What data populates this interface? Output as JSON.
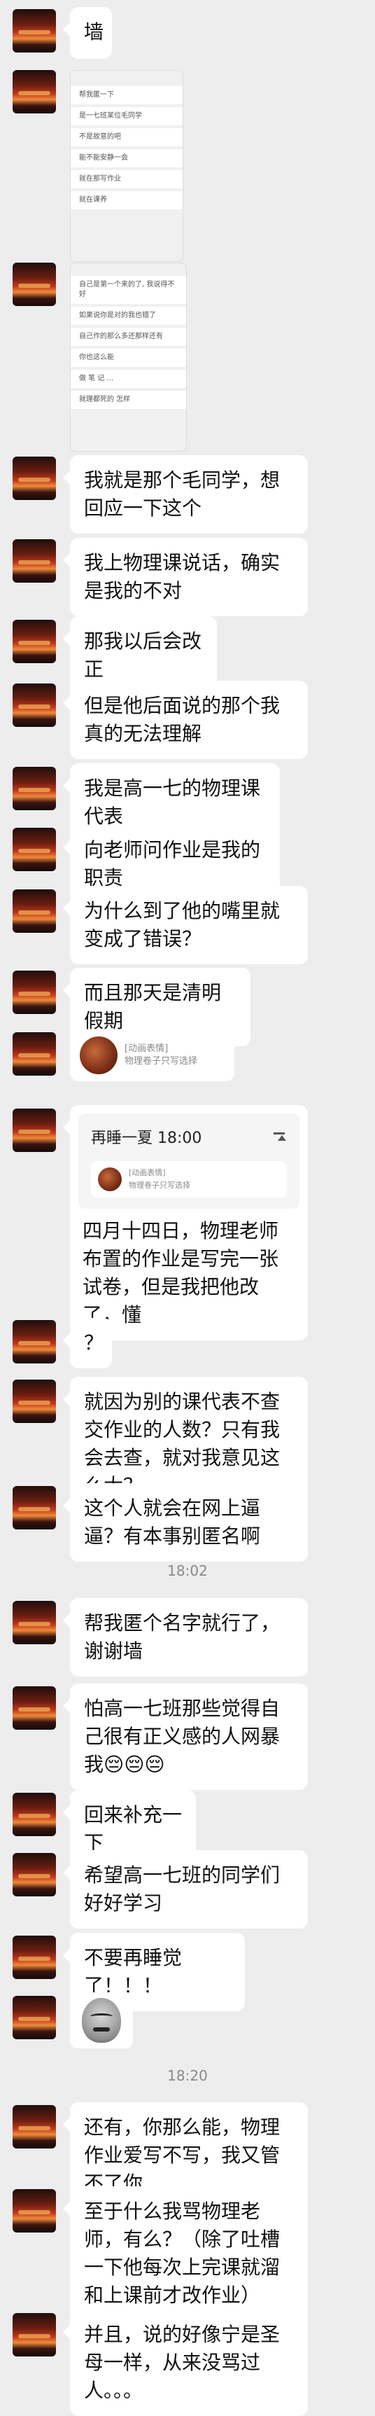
{
  "messages": {
    "m1": "墙",
    "m3": "我就是那个毛同学，想回应一下这个",
    "m4": "我上物理课说话，确实是我的不对",
    "m5": "那我以后会改正",
    "m6": "但是他后面说的那个我真的无法理解",
    "m7": "我是高一七的物理课代表",
    "m8": "向老师问作业是我的职责",
    "m9": "为什么到了他的嘴里就变成了错误？",
    "m10": "而且那天是清明假期",
    "m13": "？",
    "m14": "就因为别的课代表不查交作业的人数？只有我会去查，就对我意见这么大？",
    "m15": "这个人就会在网上逼逼？有本事别匿名啊",
    "m16": "帮我匿个名字就行了，谢谢墙",
    "m17": "怕高一七班那些觉得自己很有正义感的人网暴我😔😔😔",
    "m18": "回来补充一下",
    "m19": "希望高一七班的同学们好好学习",
    "m20": "不要再睡觉了！！！",
    "m22": "还有，你那么能，物理作业爱写不写，我又管不了你",
    "m23": "至于什么我骂物理老师，有么？（除了吐槽一下他每次上完课就溜和上课前才改作业）",
    "m24": "并且，说的好像宁是圣母一样，从来没骂过人。。。"
  },
  "times": {
    "t1": "18:02",
    "t2": "18:20"
  },
  "screenshot1": {
    "lines": [
      "帮我匿一下",
      "是一七班某位毛同学",
      "不是故意的吧",
      "能不能安静一会",
      "就在那写作业",
      "就在课养"
    ]
  },
  "screenshot2": {
    "lines": [
      "自己是第一个来的了, 我说得不好",
      "如果说你是对的我也错了",
      "自己作的那么多还那样还有",
      "你也这么能",
      "做 笔 记 ...",
      "就理都死的 怎样"
    ]
  },
  "sticker_msg": {
    "label": "[动画表情]",
    "caption": "物理卷子只写选择"
  },
  "quote_msg": {
    "header": "再睡一夏 18:00",
    "inner_label": "[动画表情]",
    "inner_caption": "物理卷子只写选择",
    "body": "四月十四日，物理老师布置的作业是写完一张试卷，但是我把他改了，懂"
  },
  "colors": {
    "background": "#ededed",
    "bubble": "#ffffff",
    "timestamp": "#8a8a8a"
  }
}
